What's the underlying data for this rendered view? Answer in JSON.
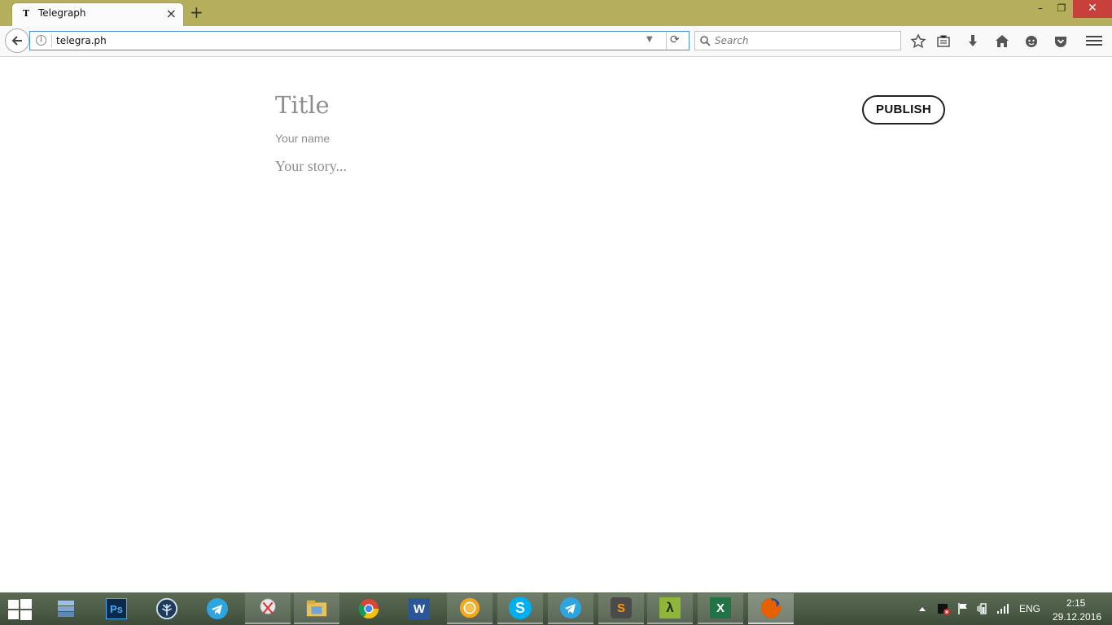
{
  "browser": {
    "tab_title": "Telegraph",
    "tab_favicon_letter": "T",
    "new_tab_label": "+",
    "close_tab_label": "×",
    "url": "telegra.ph",
    "search_placeholder": "Search",
    "toolbar_icons": [
      "star-icon",
      "reading-list-icon",
      "download-icon",
      "home-icon",
      "chat-icon",
      "pocket-icon",
      "menu-icon"
    ]
  },
  "window_controls": {
    "minimize": "–",
    "restore": "❐",
    "close": "✕"
  },
  "editor": {
    "title_placeholder": "Title",
    "author_placeholder": "Your name",
    "story_placeholder": "Your story...",
    "publish_label": "PUBLISH"
  },
  "taskbar": {
    "apps": [
      {
        "name": "database-app-icon",
        "color": "#7fa7cf"
      },
      {
        "name": "photoshop-icon",
        "label": "Ps",
        "color": "#0b2a4a"
      },
      {
        "name": "tree-app-icon",
        "color": "#1f3b5c"
      },
      {
        "name": "telegram-icon",
        "color": "#2ca5e0"
      },
      {
        "name": "snipping-tool-icon",
        "color": "#c9c9c9"
      },
      {
        "name": "file-explorer-icon",
        "color": "#e8c35a"
      },
      {
        "name": "chrome-icon",
        "color": "#db4437"
      },
      {
        "name": "word-icon",
        "label": "W",
        "color": "#2b579a"
      },
      {
        "name": "chrome-canary-icon",
        "color": "#f3a81c"
      },
      {
        "name": "skype-icon",
        "label": "S",
        "color": "#00aff0"
      },
      {
        "name": "telegram-icon-2",
        "color": "#2ca5e0"
      },
      {
        "name": "sublime-text-icon",
        "label": "S",
        "color": "#4b4b4b"
      },
      {
        "name": "lambda-app-icon",
        "label": "λ",
        "color": "#8fb63a"
      },
      {
        "name": "excel-icon",
        "label": "X",
        "color": "#217346"
      },
      {
        "name": "firefox-icon",
        "color": "#e66000"
      }
    ],
    "language": "ENG",
    "time": "2:15",
    "date": "29.12.2016"
  }
}
